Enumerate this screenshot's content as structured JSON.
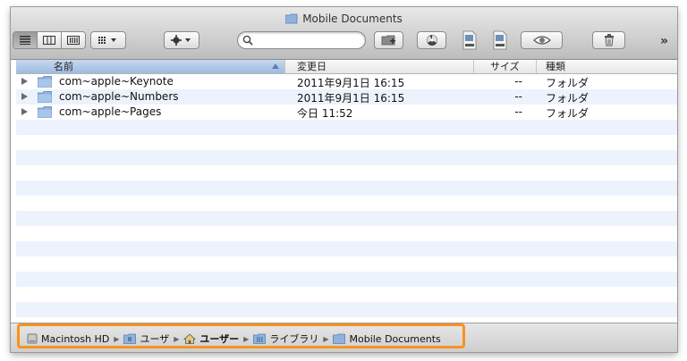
{
  "window": {
    "title": "Mobile Documents"
  },
  "toolbar": {
    "search_placeholder": "",
    "more_label": "»"
  },
  "columns": {
    "name": "名前",
    "date": "変更日",
    "size": "サイズ",
    "kind": "種類"
  },
  "rows": [
    {
      "name": "com~apple~Keynote",
      "date": "2011年9月1日 16:15",
      "size": "--",
      "kind": "フォルダ"
    },
    {
      "name": "com~apple~Numbers",
      "date": "2011年9月1日 16:15",
      "size": "--",
      "kind": "フォルダ"
    },
    {
      "name": "com~apple~Pages",
      "date": "今日 11:52",
      "size": "--",
      "kind": "フォルダ"
    }
  ],
  "path": {
    "items": [
      "Macintosh HD",
      "ユーザ",
      "ユーザー",
      "ライブラリ",
      "Mobile Documents"
    ]
  },
  "colors": {
    "accent_highlight": "#f7931e",
    "sorted_header": "#9cbbe0",
    "folder_blue": "#8fb3de"
  }
}
